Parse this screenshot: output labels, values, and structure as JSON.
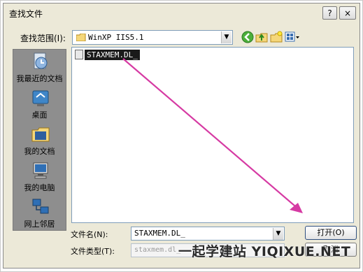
{
  "dialog": {
    "title": "查找文件",
    "help_glyph": "?",
    "close_glyph": "×"
  },
  "look_in": {
    "label": "查找范围(I):",
    "value": "WinXP IIS5.1"
  },
  "toolbar": {
    "back_icon": "back-arrow-icon",
    "up_icon": "up-folder-icon",
    "new_folder_icon": "new-folder-icon",
    "view_icon": "view-menu-icon"
  },
  "places": [
    {
      "label": "我最近的文档",
      "icon": "recent-documents-icon"
    },
    {
      "label": "桌面",
      "icon": "desktop-icon"
    },
    {
      "label": "我的文档",
      "icon": "my-documents-icon"
    },
    {
      "label": "我的电脑",
      "icon": "my-computer-icon"
    },
    {
      "label": "网上邻居",
      "icon": "network-places-icon"
    }
  ],
  "files": [
    {
      "name": "STAXMEM.DL_",
      "selected": true
    }
  ],
  "filename": {
    "label": "文件名(N):",
    "value": "STAXMEM.DL_"
  },
  "filetype": {
    "label": "文件类型(T):",
    "value": "staxmem.dl_"
  },
  "buttons": {
    "open": "打开(O)",
    "cancel": "取消"
  },
  "watermark": "一起学建站 YIQIXUE.NET",
  "colors": {
    "arrow": "#d63aa3",
    "selection": "#1a1a1a",
    "dialog_bg": "#ece9d8",
    "places_bg": "#8e8e8e"
  }
}
